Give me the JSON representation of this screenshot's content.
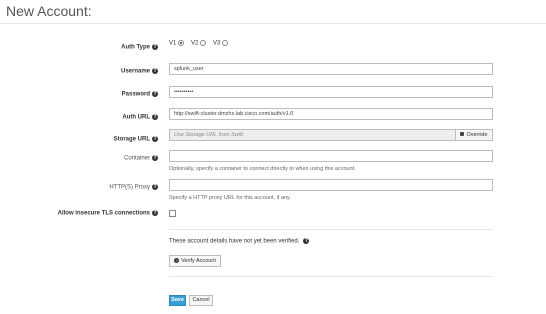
{
  "page": {
    "title": "New Account:"
  },
  "form": {
    "auth_type": {
      "label": "Auth Type",
      "options": [
        {
          "label": "V1",
          "selected": true
        },
        {
          "label": "V2",
          "selected": false
        },
        {
          "label": "V3",
          "selected": false
        }
      ]
    },
    "username": {
      "label": "Username",
      "value": "splunk_user"
    },
    "password": {
      "label": "Password",
      "value": "••••••••••"
    },
    "auth_url": {
      "label": "Auth URL",
      "value": "http://swift-cluster.dmzhx.lab.cisco.com/auth/v1.0"
    },
    "storage_url": {
      "label": "Storage URL",
      "placeholder": "Use Storage URL from Swift",
      "override_label": "Override"
    },
    "container": {
      "label": "Container",
      "value": "",
      "help": "Optionally, specify a container to connect directly to when using this account."
    },
    "proxy": {
      "label": "HTTP(S) Proxy",
      "value": "",
      "help": "Specify a HTTP proxy URL for this account, if any."
    },
    "insecure_tls": {
      "label": "Allow insecure TLS connections",
      "checked": false
    },
    "verify": {
      "note": "These account details have not yet been verified.",
      "button_label": "Verify Account"
    },
    "actions": {
      "save_label": "Save",
      "cancel_label": "Cancel"
    }
  },
  "colors": {
    "primary": "#3a9ed6",
    "border": "#bdbdbd",
    "disabled_bg": "#eeeeee"
  }
}
